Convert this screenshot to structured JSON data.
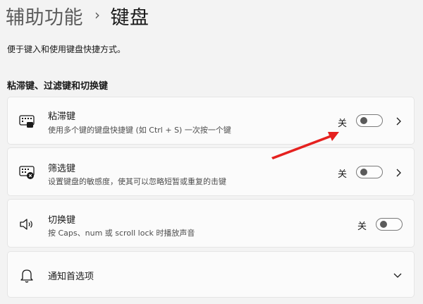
{
  "breadcrumb": {
    "parent": "辅助功能",
    "separator": "›",
    "current": "键盘"
  },
  "page": {
    "description": "便于键入和使用键盘快捷方式。"
  },
  "section": {
    "title": "粘滞键、过滤键和切换键"
  },
  "items": [
    {
      "title": "粘滞键",
      "description": "使用多个键的键盘快捷键 (如 Ctrl + S) 一次按一个键",
      "state_label": "关",
      "toggle_on": false,
      "has_chevron": true,
      "icon": "sticky-keys-icon"
    },
    {
      "title": "筛选键",
      "description": "设置键盘的敏感度，使其可以忽略短暂或重复的击键",
      "state_label": "关",
      "toggle_on": false,
      "has_chevron": true,
      "icon": "filter-keys-icon"
    },
    {
      "title": "切换键",
      "description": "按 Caps、num 或 scroll lock 时播放声音",
      "state_label": "关",
      "toggle_on": false,
      "has_chevron": false,
      "icon": "speaker-icon"
    },
    {
      "title": "通知首选项",
      "icon": "bell-icon",
      "expandable": true
    }
  ],
  "colors": {
    "background": "#f3f3f3",
    "card": "#fbfbfb",
    "annotation_arrow": "#e5211f"
  }
}
